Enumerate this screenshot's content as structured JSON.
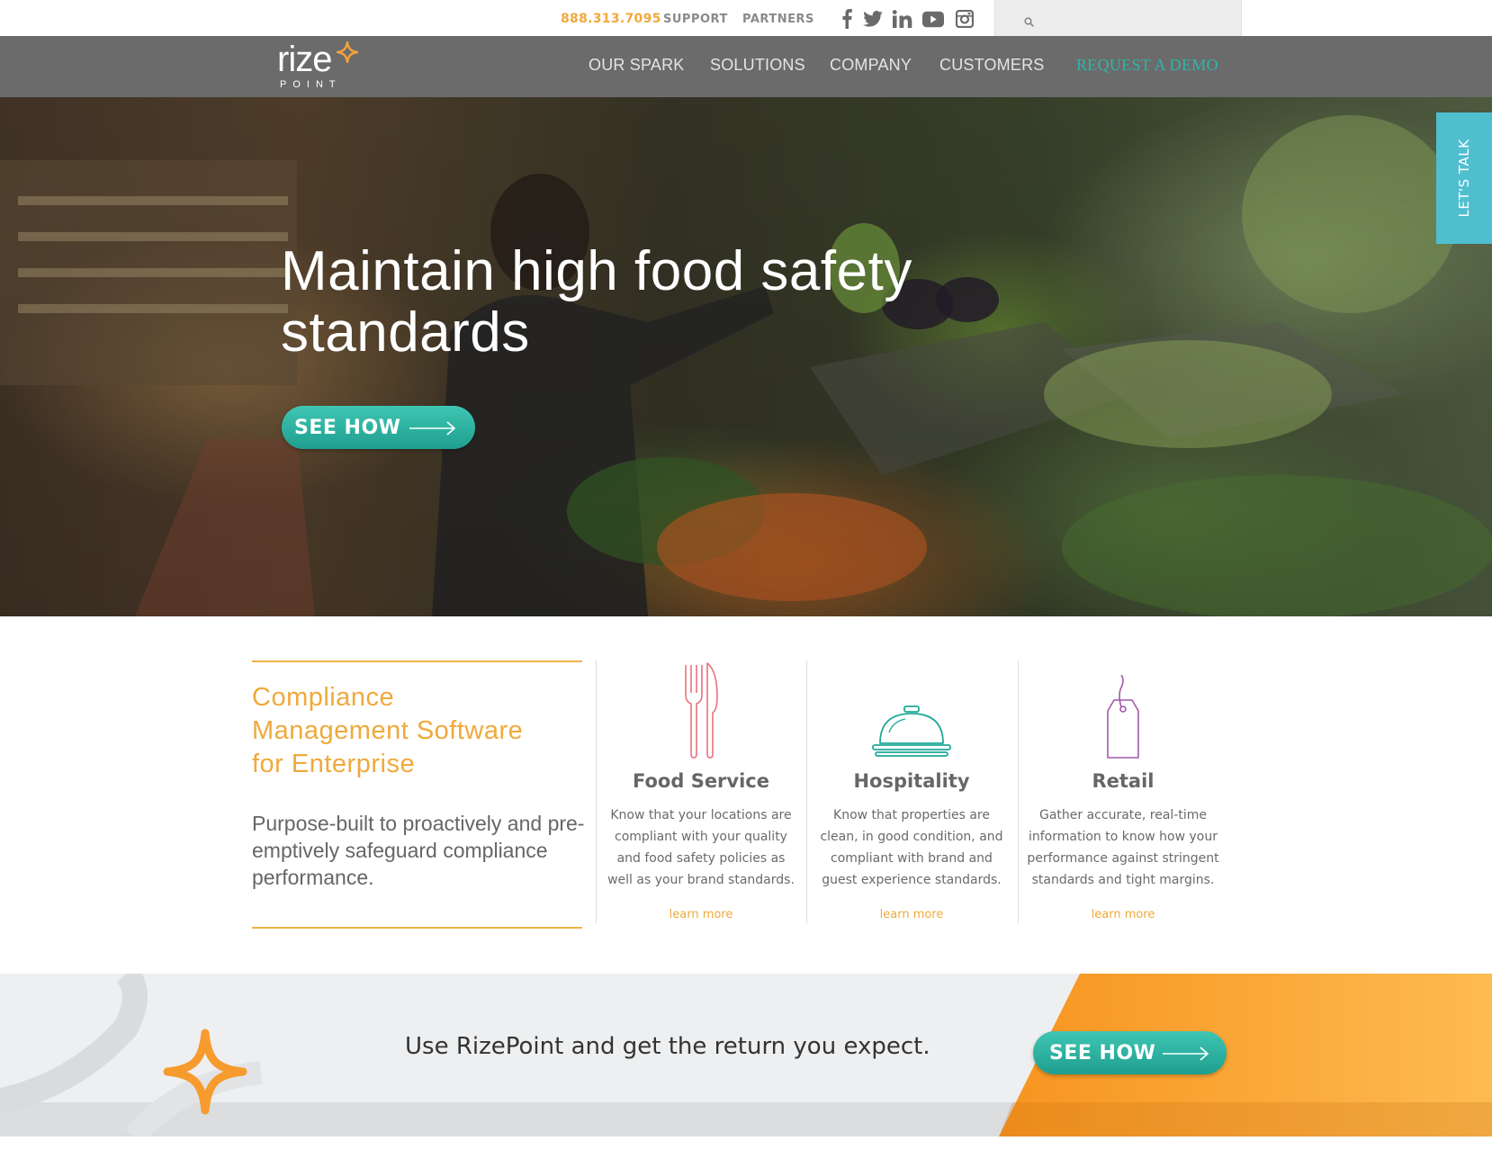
{
  "topbar": {
    "phone": "888.313.7095",
    "support": "SUPPORT",
    "partners": "PARTNERS",
    "social": [
      "facebook-icon",
      "twitter-icon",
      "linkedin-icon",
      "youtube-icon",
      "instagram-icon"
    ],
    "search_placeholder": ""
  },
  "logo": {
    "word": "rize",
    "sub": "POINT"
  },
  "nav": {
    "items": [
      "OUR SPARK",
      "SOLUTIONS",
      "COMPANY",
      "CUSTOMERS"
    ],
    "demo": "REQUEST A DEMO"
  },
  "hero": {
    "title_line1": "Maintain high food safety",
    "title_line2": "standards",
    "button": "SEE HOW"
  },
  "talk_tab": "LET'S TALK",
  "intro": {
    "title_line1": "Compliance",
    "title_line2": "Management Software",
    "title_line3": "for Enterprise",
    "desc": "Purpose-built to proactively and pre-emptively safeguard compliance performance."
  },
  "columns": [
    {
      "icon": "fork-knife-icon",
      "title": "Food Service",
      "desc": "Know that your locations are compliant with your quality and food safety policies as well as your brand standards.",
      "link": "learn more"
    },
    {
      "icon": "service-bell-icon",
      "title": "Hospitality",
      "desc": "Know that properties are clean, in good condition, and compliant with brand and guest experience standards.",
      "link": "learn more"
    },
    {
      "icon": "price-tag-icon",
      "title": "Retail",
      "desc": "Gather accurate, real-time information to know how your performance against stringent standards and tight margins.",
      "link": "learn more"
    }
  ],
  "cta": {
    "text": "Use RizePoint and get the return you expect.",
    "button": "SEE HOW"
  },
  "colors": {
    "accent_orange": "#f0a93b",
    "accent_teal": "#2fb5a8",
    "nav_bg": "#6b6b6b",
    "talk_tab": "#4fbfd0",
    "food_icon": "#e8727c",
    "hospitality_icon": "#1fa99a",
    "retail_icon": "#a35aa6"
  }
}
